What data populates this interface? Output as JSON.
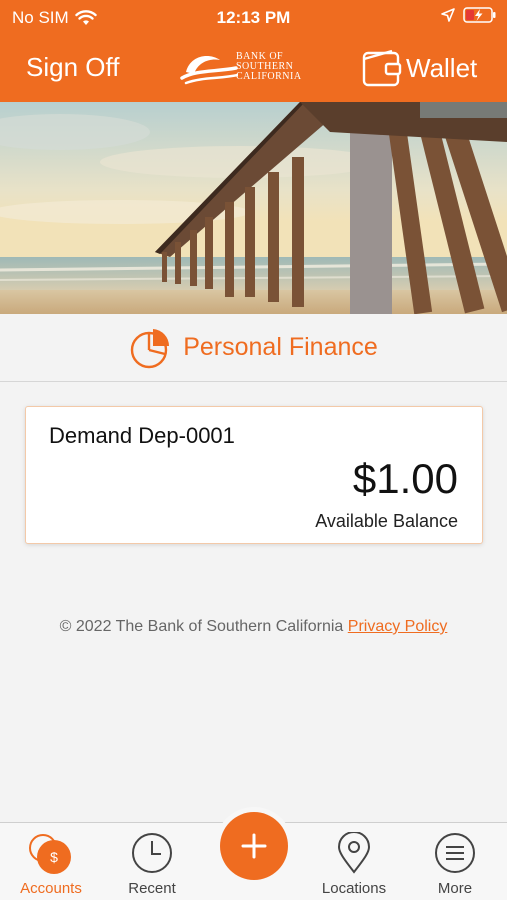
{
  "status_bar": {
    "carrier": "No SIM",
    "time": "12:13 PM"
  },
  "nav": {
    "sign_off_label": "Sign Off",
    "logo_lines": [
      "BANK OF",
      "SOUTHERN",
      "CALIFORNIA"
    ],
    "wallet_label": "Wallet"
  },
  "personal_finance": {
    "label": "Personal Finance"
  },
  "account": {
    "name": "Demand Dep-0001",
    "amount": "$1.00",
    "caption": "Available Balance"
  },
  "footer": {
    "copyright": "© 2022 The Bank of Southern California",
    "privacy_link": "Privacy Policy"
  },
  "tabs": [
    {
      "label": "Accounts",
      "icon": "accounts-icon",
      "active": true
    },
    {
      "label": "Recent",
      "icon": "clock-icon",
      "active": false
    },
    {
      "label": "Locations",
      "icon": "location-pin-icon",
      "active": false
    },
    {
      "label": "More",
      "icon": "menu-icon",
      "active": false
    }
  ],
  "colors": {
    "brand_orange": "#ef6c20",
    "background": "#f3f3f3"
  }
}
